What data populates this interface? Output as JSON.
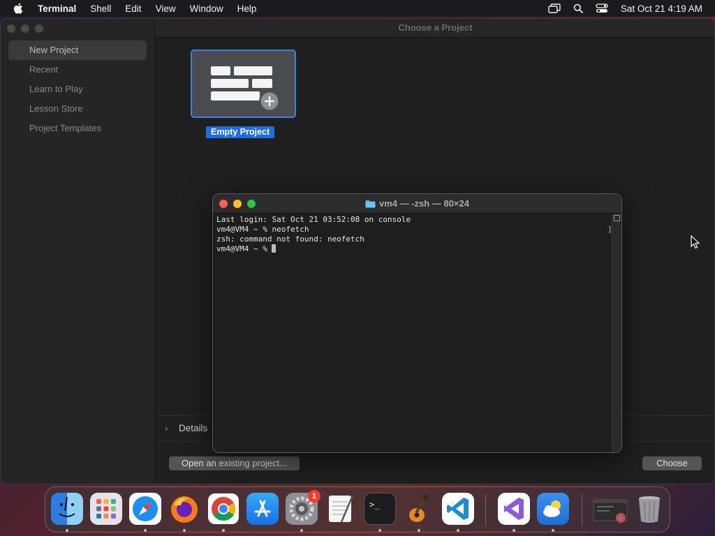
{
  "menubar": {
    "app_name": "Terminal",
    "items": [
      "Shell",
      "Edit",
      "View",
      "Window",
      "Help"
    ],
    "clock": "Sat Oct 21  4:19 AM",
    "status_icons": [
      "screen-mirroring-icon",
      "search-icon",
      "control-center-icon"
    ]
  },
  "app_window": {
    "header_title": "Choose a Project",
    "sidebar_items": [
      {
        "label": "New Project",
        "selected": true
      },
      {
        "label": "Recent",
        "selected": false
      },
      {
        "label": "Learn to Play",
        "selected": false
      },
      {
        "label": "Lesson Store",
        "selected": false
      },
      {
        "label": "Project Templates",
        "selected": false
      }
    ],
    "template": {
      "label": "Empty Project"
    },
    "details_label": "Details",
    "open_existing_label": "Open an existing project...",
    "choose_label": "Choose"
  },
  "terminal": {
    "title": "vm4 — -zsh — 80×24",
    "lines": [
      "Last login: Sat Oct 21 03:52:08 on console",
      "vm4@VM4 ~ % neofetch",
      "zsh: command not found: neofetch",
      "vm4@VM4 ~ % "
    ]
  },
  "dock": {
    "apps": [
      {
        "name": "finder-icon",
        "color": "#3a8ff2"
      },
      {
        "name": "launchpad-icon",
        "color": "#d9d9de"
      },
      {
        "name": "safari-icon",
        "color": "#1e8ef0"
      },
      {
        "name": "firefox-icon",
        "color": "#ff7a1a"
      },
      {
        "name": "chrome-icon",
        "color": "#ffffff"
      },
      {
        "name": "app-store-icon",
        "color": "#1f8ff5"
      },
      {
        "name": "system-settings-icon",
        "color": "#8e8e93"
      },
      {
        "name": "textedit-icon",
        "color": "#f2f2f2"
      },
      {
        "name": "terminal-icon",
        "color": "#1c1c1e"
      },
      {
        "name": "garageband-icon",
        "color": "#3a2a1e"
      },
      {
        "name": "vscode-icon",
        "color": "#ffffff"
      },
      {
        "name": "visual-studio-icon",
        "color": "#ffffff"
      },
      {
        "name": "weather-icon",
        "color": "#2f84e6"
      },
      {
        "name": "chrome-app-window-icon",
        "color": "#2d2d2d"
      },
      {
        "name": "trash-icon",
        "color": "#9a9a9f"
      }
    ],
    "settings_badge": "1"
  }
}
